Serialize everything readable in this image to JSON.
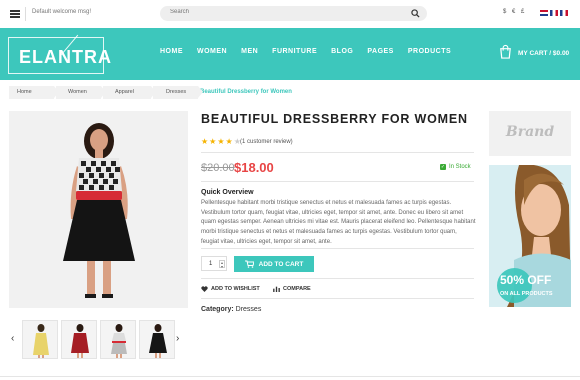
{
  "topbar": {
    "welcome": "Default welcome msg!",
    "search_placeholder": "Search",
    "currencies": "$ € £"
  },
  "header": {
    "logo": "ELANTRA",
    "nav": [
      "HOME",
      "WOMEN",
      "MEN",
      "FURNITURE",
      "BLOG",
      "PAGES",
      "PRODUCTS"
    ],
    "cart_label": "MY CART / $0.00"
  },
  "breadcrumb": {
    "items": [
      "Home",
      "Women",
      "Apparel",
      "Dresses"
    ],
    "current": "Beautiful Dressberry for Women"
  },
  "product": {
    "title": "BEAUTIFUL DRESSBERRY FOR WOMEN",
    "rating": 4,
    "review_text": "(1 customer review)",
    "old_price": "$20.00",
    "new_price": "$18.00",
    "stock": "In Stock",
    "overview_title": "Quick Overview",
    "overview_text": "Pellentesque habitant morbi tristique senectus et netus et malesuada fames ac turpis egestas. Vestibulum tortor quam, feugiat vitae, ultricies eget, tempor sit amet, ante. Donec eu libero sit amet quam egestas semper. Aenean ultricies mi vitae est. Mauris placerat eleifend leo. Pellentesque habitant morbi tristique senectus et netus et malesuada fames ac turpis egestas. Vestibulum tortor quam, feugiat vitae, ultricies eget, tempor sit amet, ante.",
    "quantity": "1",
    "add_to_cart": "ADD TO CART",
    "wishlist": "ADD TO WISHLIST",
    "compare": "COMPARE",
    "category_label": "Category:",
    "category_value": "Dresses"
  },
  "sidebar": {
    "brand": "Brand",
    "promo_off": "50% OFF",
    "promo_all": "ON ALL PRODUCTS"
  },
  "colors": {
    "accent": "#3dc7bc",
    "price": "#e84545",
    "stock": "#3aaa35"
  }
}
